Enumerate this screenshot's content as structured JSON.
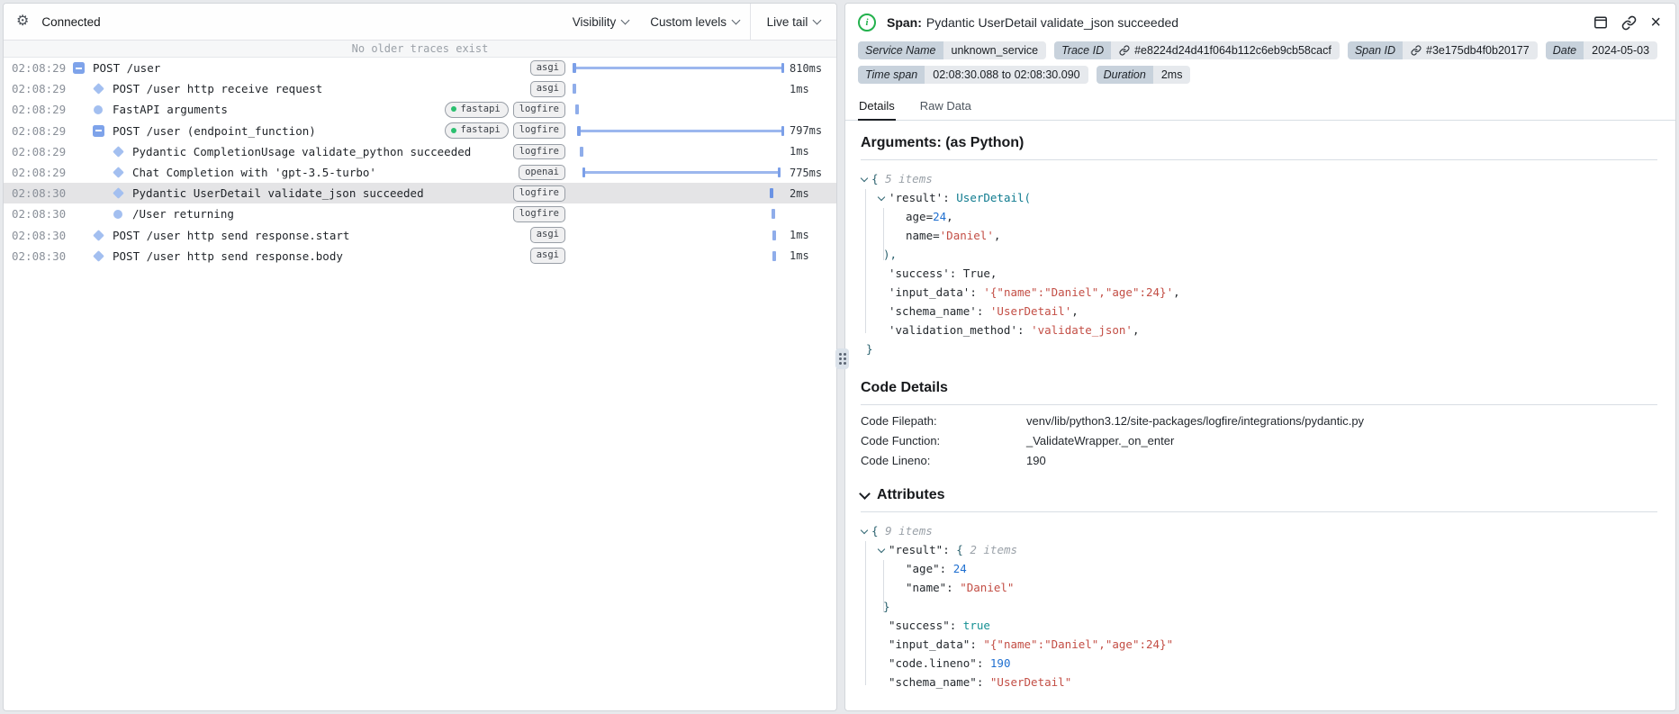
{
  "toolbar": {
    "status": "Connected",
    "visibility": "Visibility",
    "custom_levels": "Custom levels",
    "live_tail": "Live tail"
  },
  "trace_list": {
    "banner": "No older traces exist",
    "rows": [
      {
        "time": "02:08:29",
        "icon": "minus-square",
        "indent": 0,
        "label": "POST /user",
        "badges": [
          "asgi"
        ],
        "bar": {
          "kind": "range",
          "start": 0,
          "end": 100
        },
        "duration": "810ms",
        "selected": false
      },
      {
        "time": "02:08:29",
        "icon": "diamond",
        "indent": 1,
        "label": "POST /user http receive request",
        "badges": [
          "asgi"
        ],
        "bar": {
          "kind": "tick",
          "start": 0
        },
        "duration": "1ms",
        "selected": false
      },
      {
        "time": "02:08:29",
        "icon": "circle",
        "indent": 1,
        "label": "FastAPI arguments",
        "badges": [
          "fastapi",
          "logfire"
        ],
        "bar": {
          "kind": "tick",
          "start": 1.2
        },
        "duration": "",
        "selected": false
      },
      {
        "time": "02:08:29",
        "icon": "minus-square",
        "indent": 1,
        "label": "POST /user (endpoint_function)",
        "badges": [
          "fastapi",
          "logfire"
        ],
        "bar": {
          "kind": "range",
          "start": 2.2,
          "end": 100
        },
        "duration": "797ms",
        "selected": false
      },
      {
        "time": "02:08:29",
        "icon": "diamond",
        "indent": 2,
        "label": "Pydantic CompletionUsage validate_python succeeded",
        "badges": [
          "logfire"
        ],
        "bar": {
          "kind": "tick",
          "start": 3.6
        },
        "duration": "1ms",
        "selected": false
      },
      {
        "time": "02:08:29",
        "icon": "diamond",
        "indent": 2,
        "label": "Chat Completion with 'gpt-3.5-turbo'",
        "badges": [
          "openai"
        ],
        "bar": {
          "kind": "range",
          "start": 4.6,
          "end": 98.3
        },
        "duration": "775ms",
        "selected": false
      },
      {
        "time": "02:08:30",
        "icon": "diamond",
        "indent": 2,
        "label": "Pydantic UserDetail validate_json succeeded",
        "badges": [
          "logfire"
        ],
        "bar": {
          "kind": "tick",
          "start": 93.4
        },
        "duration": "2ms",
        "selected": true
      },
      {
        "time": "02:08:30",
        "icon": "circle",
        "indent": 2,
        "label": "/User returning",
        "badges": [
          "logfire"
        ],
        "bar": {
          "kind": "tick",
          "start": 94.0
        },
        "duration": "",
        "selected": false
      },
      {
        "time": "02:08:30",
        "icon": "diamond",
        "indent": 1,
        "label": "POST /user http send response.start",
        "badges": [
          "asgi"
        ],
        "bar": {
          "kind": "tick",
          "start": 94.6
        },
        "duration": "1ms",
        "selected": false
      },
      {
        "time": "02:08:30",
        "icon": "diamond",
        "indent": 1,
        "label": "POST /user http send response.body",
        "badges": [
          "asgi"
        ],
        "bar": {
          "kind": "tick",
          "start": 94.6
        },
        "duration": "1ms",
        "selected": false
      }
    ]
  },
  "span_panel": {
    "kind_label": "Span:",
    "title": "Pydantic UserDetail validate_json succeeded",
    "meta": [
      {
        "label": "Service Name",
        "value": "unknown_service",
        "link": false
      },
      {
        "label": "Trace ID",
        "value": "#e8224d24d41f064b112c6eb9cb58cacf",
        "link": true
      },
      {
        "label": "Span ID",
        "value": "#3e175db4f0b20177",
        "link": true
      },
      {
        "label": "Date",
        "value": "2024-05-03",
        "link": false
      },
      {
        "label": "Time span",
        "value": "02:08:30.088 to 02:08:30.090",
        "link": false
      },
      {
        "label": "Duration",
        "value": "2ms",
        "link": false
      }
    ],
    "tabs": [
      {
        "label": "Details",
        "active": true
      },
      {
        "label": "Raw Data",
        "active": false
      }
    ],
    "arguments_heading": "Arguments: (as Python)",
    "arguments_tree": [
      {
        "indent": 0,
        "chev": true,
        "tokens": [
          [
            "punc",
            "{ "
          ],
          [
            "meta",
            "5 items"
          ]
        ]
      },
      {
        "indent": 1,
        "chev": true,
        "tokens": [
          [
            "key",
            "'result'"
          ],
          [
            "plain",
            ": "
          ],
          [
            "type",
            "UserDetail("
          ]
        ]
      },
      {
        "indent": 2,
        "chev": false,
        "tokens": [
          [
            "plain",
            "age="
          ],
          [
            "num",
            "24"
          ],
          [
            "plain",
            ","
          ]
        ]
      },
      {
        "indent": 2,
        "chev": false,
        "tokens": [
          [
            "plain",
            "name="
          ],
          [
            "str",
            "'Daniel'"
          ],
          [
            "plain",
            ","
          ]
        ]
      },
      {
        "indent": 1,
        "chev": false,
        "close": true,
        "tokens": [
          [
            "punc",
            "),"
          ]
        ]
      },
      {
        "indent": 1,
        "chev": false,
        "tokens": [
          [
            "key",
            "'success'"
          ],
          [
            "plain",
            ": "
          ],
          [
            "plain",
            "True,"
          ]
        ]
      },
      {
        "indent": 1,
        "chev": false,
        "tokens": [
          [
            "key",
            "'input_data'"
          ],
          [
            "plain",
            ": "
          ],
          [
            "str",
            "'{\"name\":\"Daniel\",\"age\":24}'"
          ],
          [
            "plain",
            ","
          ]
        ]
      },
      {
        "indent": 1,
        "chev": false,
        "tokens": [
          [
            "key",
            "'schema_name'"
          ],
          [
            "plain",
            ": "
          ],
          [
            "str",
            "'UserDetail'"
          ],
          [
            "plain",
            ","
          ]
        ]
      },
      {
        "indent": 1,
        "chev": false,
        "tokens": [
          [
            "key",
            "'validation_method'"
          ],
          [
            "plain",
            ": "
          ],
          [
            "str",
            "'validate_json'"
          ],
          [
            "plain",
            ","
          ]
        ]
      },
      {
        "indent": 0,
        "chev": false,
        "close": true,
        "tokens": [
          [
            "punc",
            "}"
          ]
        ]
      }
    ],
    "code_details": {
      "heading": "Code Details",
      "rows": [
        {
          "label": "Code Filepath:",
          "value": "venv/lib/python3.12/site-packages/logfire/integrations/pydantic.py"
        },
        {
          "label": "Code Function:",
          "value": "_ValidateWrapper._on_enter"
        },
        {
          "label": "Code Lineno:",
          "value": "190"
        }
      ]
    },
    "attributes_heading": "Attributes",
    "attributes_tree": [
      {
        "indent": 0,
        "chev": true,
        "tokens": [
          [
            "punc",
            "{ "
          ],
          [
            "meta",
            "9 items"
          ]
        ]
      },
      {
        "indent": 1,
        "chev": true,
        "tokens": [
          [
            "key",
            "\"result\""
          ],
          [
            "plain",
            ": "
          ],
          [
            "punc",
            "{ "
          ],
          [
            "meta",
            "2 items"
          ]
        ]
      },
      {
        "indent": 2,
        "chev": false,
        "tokens": [
          [
            "key",
            "\"age\""
          ],
          [
            "plain",
            ": "
          ],
          [
            "num",
            "24"
          ]
        ]
      },
      {
        "indent": 2,
        "chev": false,
        "tokens": [
          [
            "key",
            "\"name\""
          ],
          [
            "plain",
            ": "
          ],
          [
            "str",
            "\"Daniel\""
          ]
        ]
      },
      {
        "indent": 1,
        "chev": false,
        "close": true,
        "tokens": [
          [
            "punc",
            "}"
          ]
        ]
      },
      {
        "indent": 1,
        "chev": false,
        "tokens": [
          [
            "key",
            "\"success\""
          ],
          [
            "plain",
            ": "
          ],
          [
            "bool",
            "true"
          ]
        ]
      },
      {
        "indent": 1,
        "chev": false,
        "tokens": [
          [
            "key",
            "\"input_data\""
          ],
          [
            "plain",
            ": "
          ],
          [
            "str",
            "\"{\"name\":\"Daniel\",\"age\":24}\""
          ]
        ]
      },
      {
        "indent": 1,
        "chev": false,
        "tokens": [
          [
            "key",
            "\"code.lineno\""
          ],
          [
            "plain",
            ": "
          ],
          [
            "num",
            "190"
          ]
        ]
      },
      {
        "indent": 1,
        "chev": false,
        "tokens": [
          [
            "key",
            "\"schema_name\""
          ],
          [
            "plain",
            ": "
          ],
          [
            "str",
            "\"UserDetail\""
          ]
        ]
      }
    ]
  },
  "colors": {
    "accent_blue_bar": "#9cb7ee",
    "accent_blue_cap": "#7b9fe8",
    "badge_green_dot": "#2bbf6f",
    "info_green": "#23b14d",
    "string_red": "#c34e45",
    "number_blue": "#1f6fd0",
    "teal": "#0f7b8f",
    "selected_row": "#e4e4e6"
  }
}
